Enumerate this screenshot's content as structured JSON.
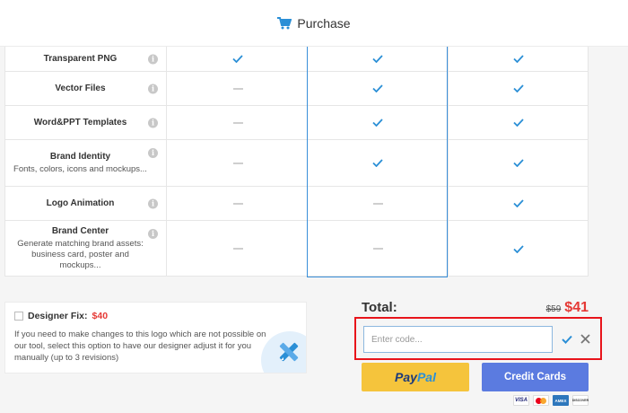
{
  "header": {
    "title": "Purchase",
    "icon": "cart-icon"
  },
  "features": [
    {
      "name": "Transparent PNG",
      "desc": "",
      "cols": [
        "check",
        "check",
        "check"
      ]
    },
    {
      "name": "Vector Files",
      "desc": "",
      "cols": [
        "dash",
        "check",
        "check"
      ]
    },
    {
      "name": "Word&PPT Templates",
      "desc": "",
      "cols": [
        "dash",
        "check",
        "check"
      ]
    },
    {
      "name": "Brand Identity",
      "desc": "Fonts, colors, icons and mockups...",
      "cols": [
        "dash",
        "check",
        "check"
      ]
    },
    {
      "name": "Logo Animation",
      "desc": "",
      "cols": [
        "dash",
        "dash",
        "check"
      ]
    },
    {
      "name": "Brand Center",
      "desc": "Generate matching brand assets: business card, poster and mockups...",
      "cols": [
        "dash",
        "dash",
        "check"
      ]
    }
  ],
  "designer_fix": {
    "label": "Designer Fix:",
    "price": "$40",
    "text": "If you need to make changes to this logo which are not possible on our tool, select this option to have our designer adjust it for you manually (up to 3 revisions)"
  },
  "total": {
    "label": "Total:",
    "old_price": "$59",
    "new_price": "$41"
  },
  "promo": {
    "placeholder": "Enter code..."
  },
  "buttons": {
    "paypal_a": "Pay",
    "paypal_b": "Pal",
    "credit": "Credit Cards"
  },
  "cards": [
    "VISA",
    "AMEX",
    "DISCOVER"
  ],
  "colors": {
    "accent": "#3a8fd9",
    "price_red": "#e53935",
    "paypal": "#f5c43c",
    "credit": "#5b7be0",
    "promo_border": "#e8141b"
  }
}
